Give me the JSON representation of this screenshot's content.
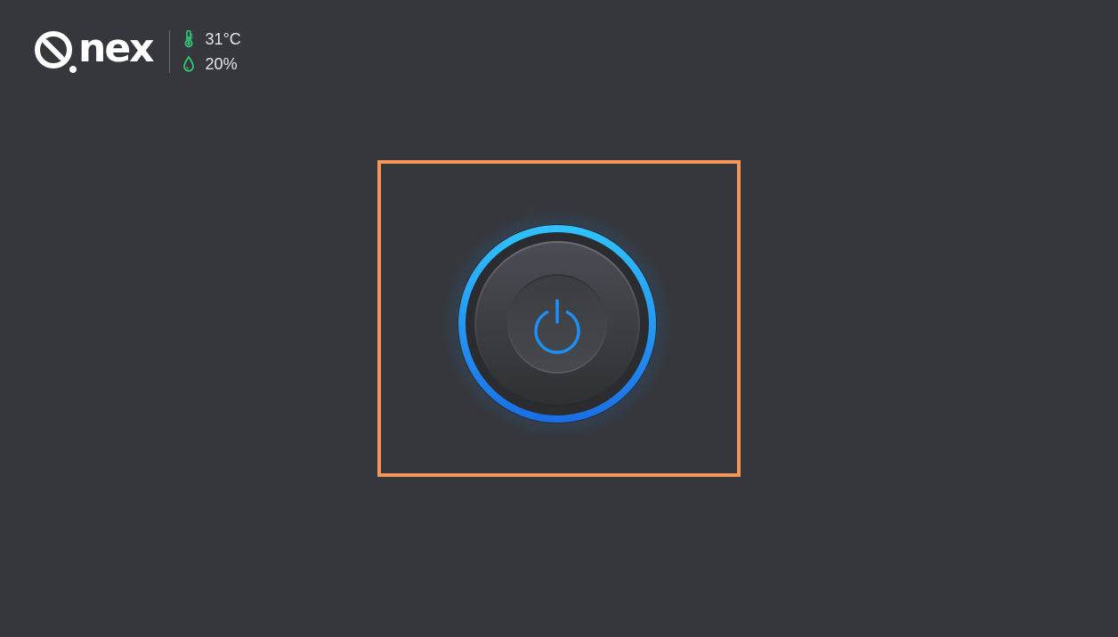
{
  "brand": {
    "name": "nex",
    "logo_icon": "qnex-logo-mark"
  },
  "sensors": {
    "temperature": {
      "icon": "thermometer-icon",
      "value": "31°C"
    },
    "humidity": {
      "icon": "droplet-icon",
      "value": "20%"
    }
  },
  "power_button": {
    "icon": "power-icon",
    "state": "on"
  },
  "colors": {
    "background": "#35373c",
    "text": "#e4e6ea",
    "sensor_icon": "#2ed47a",
    "accent_blue": "#1e9bf0",
    "highlight": "#f2975b"
  }
}
